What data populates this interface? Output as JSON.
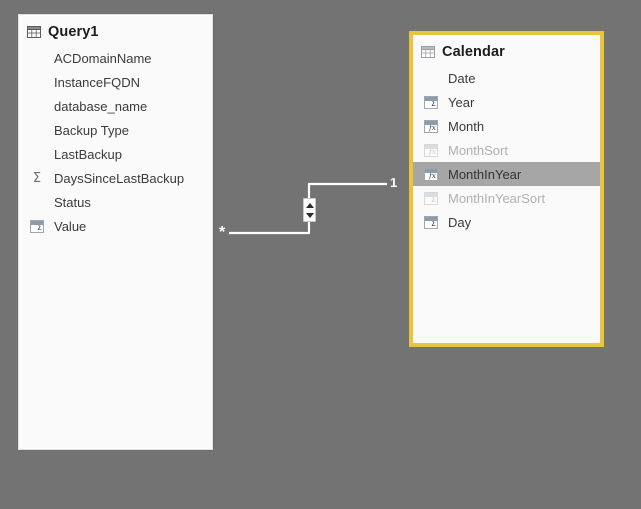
{
  "canvas": {
    "background_color": "#737373",
    "name": "power-bi-model-relationship-view"
  },
  "tables": [
    {
      "name": "Query1",
      "title": "Query1",
      "selected": false,
      "border_color": "#e2e2e2",
      "background_color": "#fafafa",
      "header_icon": "table-grid-icon",
      "fields": [
        {
          "label": "ACDomainName",
          "icon": "none",
          "dim": false,
          "highlighted": false
        },
        {
          "label": "InstanceFQDN",
          "icon": "none",
          "dim": false,
          "highlighted": false
        },
        {
          "label": "database_name",
          "icon": "none",
          "dim": false,
          "highlighted": false
        },
        {
          "label": "Backup Type",
          "icon": "none",
          "dim": false,
          "highlighted": false
        },
        {
          "label": "LastBackup",
          "icon": "none",
          "dim": false,
          "highlighted": false
        },
        {
          "label": "DaysSinceLastBackup",
          "icon": "sigma-icon",
          "dim": false,
          "highlighted": false
        },
        {
          "label": "Status",
          "icon": "none",
          "dim": false,
          "highlighted": false
        },
        {
          "label": "Value",
          "icon": "summarized-column-icon",
          "dim": false,
          "highlighted": false
        }
      ]
    },
    {
      "name": "Calendar",
      "title": "Calendar",
      "selected": true,
      "border_color": "#e8c53c",
      "background_color": "#fafafa",
      "header_icon": "table-grid-icon",
      "fields": [
        {
          "label": "Date",
          "icon": "none",
          "dim": false,
          "highlighted": false
        },
        {
          "label": "Year",
          "icon": "summarized-column-icon",
          "dim": false,
          "highlighted": false
        },
        {
          "label": "Month",
          "icon": "calculated-column-icon",
          "dim": false,
          "highlighted": false
        },
        {
          "label": "MonthSort",
          "icon": "calculated-column-icon",
          "dim": true,
          "highlighted": false
        },
        {
          "label": "MonthInYear",
          "icon": "calculated-column-icon",
          "dim": false,
          "highlighted": true
        },
        {
          "label": "MonthInYearSort",
          "icon": "summarized-column-icon",
          "dim": true,
          "highlighted": false
        },
        {
          "label": "Day",
          "icon": "summarized-column-icon",
          "dim": false,
          "highlighted": false
        }
      ]
    }
  ],
  "relationship": {
    "name": "query1-to-calendar-relationship",
    "many_side_label": "*",
    "one_side_label": "1",
    "line_color": "#ffffff",
    "cross_filter_direction": "both",
    "badge_icon": "crossfilter-both-directions-icon"
  }
}
